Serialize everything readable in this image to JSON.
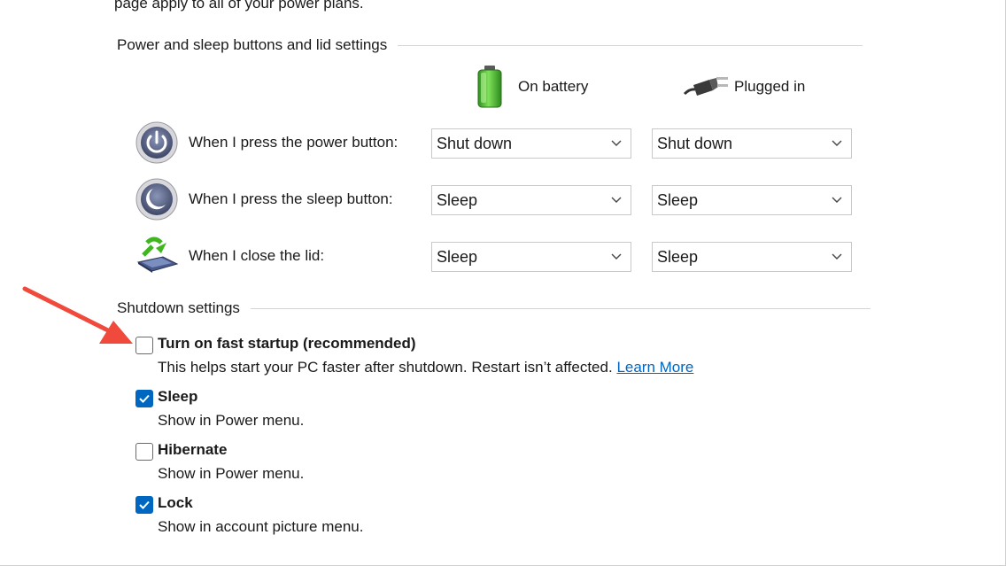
{
  "intro_text": "page apply to all of your power plans.",
  "buttons_section": {
    "title": "Power and sleep buttons and lid settings",
    "col_battery": "On battery",
    "col_plugged": "Plugged in",
    "rows": [
      {
        "label": "When I press the power button:",
        "battery": "Shut down",
        "plugged": "Shut down"
      },
      {
        "label": "When I press the sleep button:",
        "battery": "Sleep",
        "plugged": "Sleep"
      },
      {
        "label": "When I close the lid:",
        "battery": "Sleep",
        "plugged": "Sleep"
      }
    ]
  },
  "shutdown_section": {
    "title": "Shutdown settings",
    "options": [
      {
        "title": "Turn on fast startup (recommended)",
        "desc": "This helps start your PC faster after shutdown. Restart isn’t affected.",
        "link": "Learn More",
        "checked": false
      },
      {
        "title": "Sleep",
        "desc": "Show in Power menu.",
        "checked": true
      },
      {
        "title": "Hibernate",
        "desc": "Show in Power menu.",
        "checked": false
      },
      {
        "title": "Lock",
        "desc": "Show in account picture menu.",
        "checked": true
      }
    ]
  },
  "colors": {
    "accent": "#0067c0",
    "annotation_arrow": "#ef4a3c"
  }
}
